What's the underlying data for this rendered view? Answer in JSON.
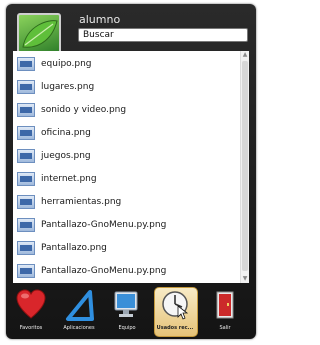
{
  "user": {
    "name": "alumno"
  },
  "search": {
    "value": "Buscar"
  },
  "files": [
    {
      "name": "equipo.png"
    },
    {
      "name": "lugares.png"
    },
    {
      "name": "sonido y video.png"
    },
    {
      "name": "oficina.png"
    },
    {
      "name": "juegos.png"
    },
    {
      "name": "internet.png"
    },
    {
      "name": "herramientas.png"
    },
    {
      "name": "Pantallazo-GnoMenu.py.png"
    },
    {
      "name": "Pantallazo.png"
    },
    {
      "name": "Pantallazo-GnoMenu.py.png"
    }
  ],
  "dock": {
    "favorites": "Favoritos",
    "applications": "Aplicaciones",
    "computer": "Equipo",
    "recent": "Usados rec...",
    "logout": "Salir"
  },
  "colors": {
    "menu_bg": "#1c1c1c",
    "active_tab": "#e6c378",
    "heart": "#d9262b"
  },
  "icons": {
    "file": "image-file-icon",
    "favorites": "heart-icon",
    "applications": "triangle-icon",
    "computer": "monitor-icon",
    "recent": "clock-icon",
    "logout": "exit-door-icon"
  }
}
